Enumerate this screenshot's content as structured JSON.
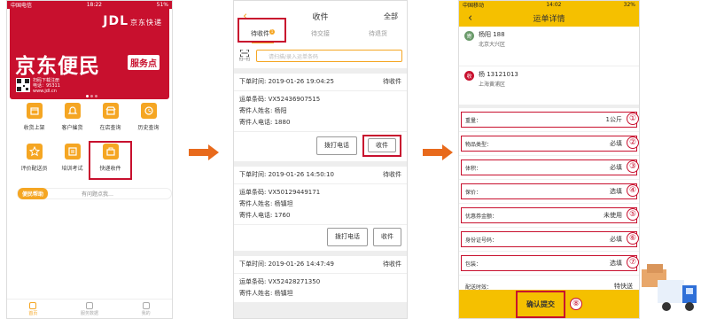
{
  "phone1": {
    "status": {
      "carrier": "中国电信",
      "time": "18:22",
      "battery": "51%"
    },
    "brand": "JDL",
    "brand_sub": "京东快递",
    "banner_title": "京东便民",
    "banner_badge": "服务点",
    "qr_text": [
      "扫码下载注册",
      "电话：95311",
      "www.jdl.cn"
    ],
    "grid": [
      "收货上架",
      "客户催货",
      "在店查询",
      "历史查询",
      "评价配送员",
      "培训考试",
      "快递收件"
    ],
    "help_label": "便民帮助",
    "help_question": "有问题点我…",
    "tabs": [
      "首页",
      "服务数据",
      "我的"
    ]
  },
  "phone2": {
    "title": "收件",
    "right": "全部",
    "tabs": [
      "待收件",
      "待交接",
      "待退货"
    ],
    "badge": "1",
    "scan_label": "扫一扫",
    "search_placeholder": "请扫描/录入运单条码",
    "orders": [
      {
        "time": "下单时间: 2019-01-26 19:04:25",
        "status": "待收件",
        "code": "运单条码: VX52436907515",
        "sender": "寄件人姓名: 杨阳",
        "phone": "寄件人电话: 1880"
      },
      {
        "time": "下单时间: 2019-01-26 14:50:10",
        "status": "待收件",
        "code": "运单条码: VX50129449171",
        "sender": "寄件人姓名: 杨镇坦",
        "phone": "寄件人电话: 1760"
      },
      {
        "time": "下单时间: 2019-01-26 14:47:49",
        "status": "待收件",
        "code": "运单条码: VX52428271350",
        "sender": "寄件人姓名: 杨镇坦",
        "phone": ""
      }
    ],
    "btn_call": "拨打电话",
    "btn_receive": "收件"
  },
  "phone3": {
    "status": {
      "carrier": "中国移动",
      "time": "14:02",
      "battery": "32%"
    },
    "title": "运单详情",
    "sender": {
      "tag": "寄",
      "name": "杨阳  188",
      "addr": "北京大兴区"
    },
    "receiver": {
      "tag": "收",
      "name": "杨  13121013",
      "addr": "上海黄浦区"
    },
    "rows": [
      {
        "label": "重量：",
        "value": "1公斤",
        "num": "①"
      },
      {
        "label": "物品类型：",
        "value": "必填",
        "num": "②"
      },
      {
        "label": "体积：",
        "value": "必填",
        "num": "③"
      },
      {
        "label": "保价：",
        "value": "选填",
        "num": "④"
      },
      {
        "label": "优惠券金额：",
        "value": "未使用",
        "num": "⑤"
      },
      {
        "label": "身份证号码：",
        "value": "必填",
        "num": "⑥"
      },
      {
        "label": "包装：",
        "value": "选填",
        "num": "⑦"
      }
    ],
    "delivery": {
      "label": "配送时效：",
      "value": "特快送"
    },
    "confirm": "确认提交",
    "confirm_num": "⑧"
  },
  "colors": {
    "red": "#c8102e",
    "orange": "#f5a623",
    "yellow": "#f5c000"
  }
}
